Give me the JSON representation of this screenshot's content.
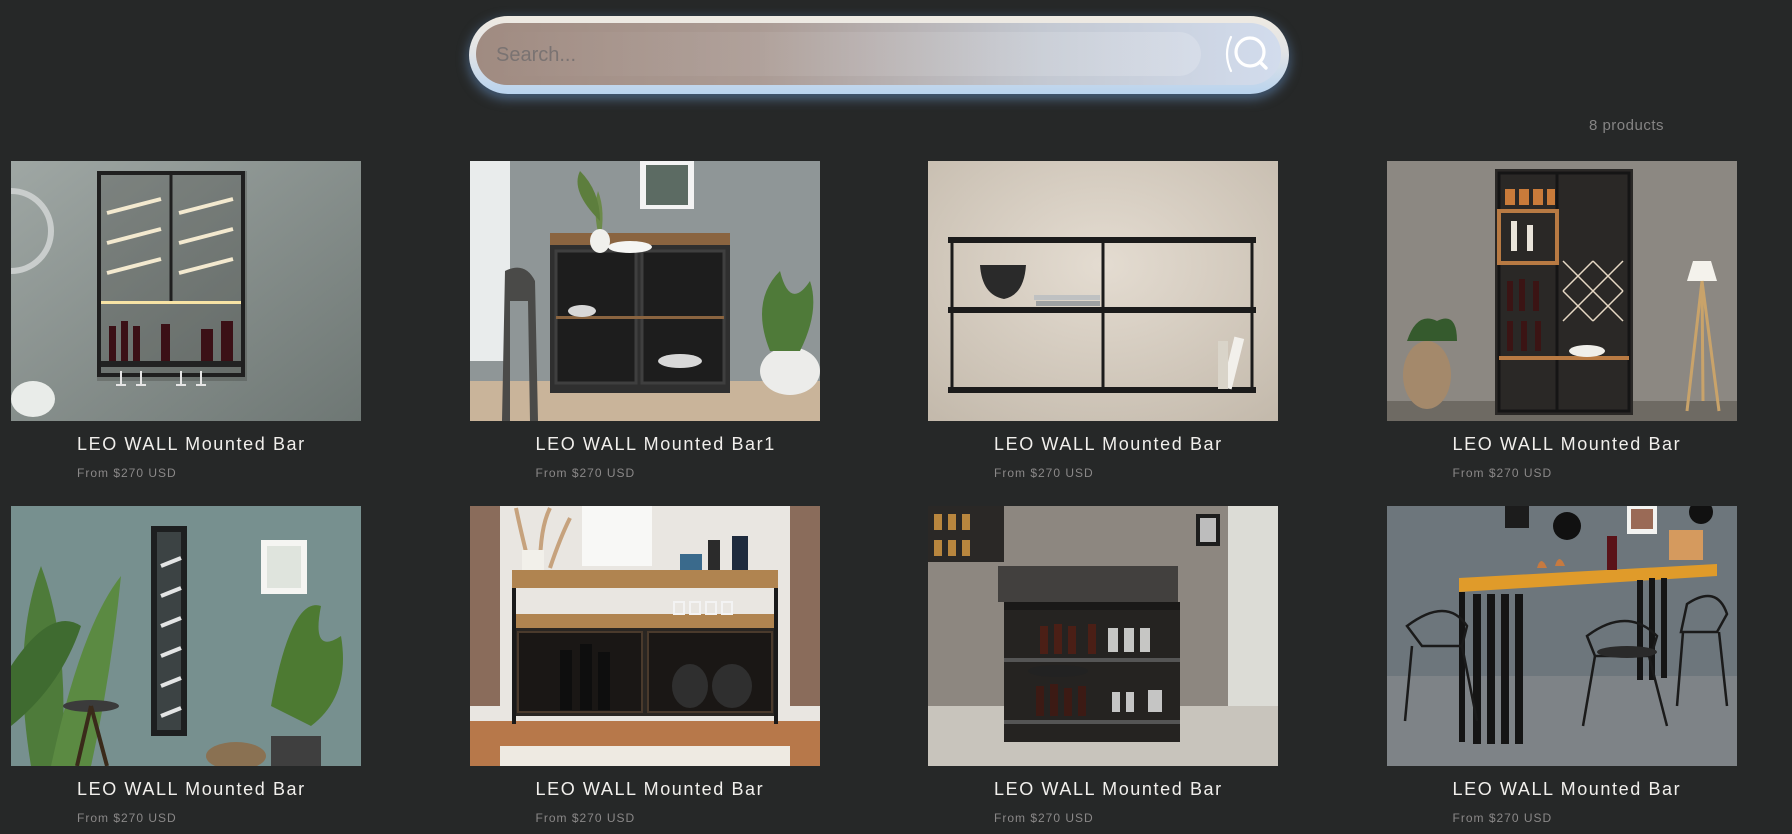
{
  "search": {
    "placeholder": "Search...",
    "value": "",
    "icon": "search-icon"
  },
  "results": {
    "count_label": "8 products"
  },
  "products": [
    {
      "title": "LEO WALL Mounted Bar",
      "price": "From $270 USD",
      "image": "wall-wine-rack-photo"
    },
    {
      "title": "LEO WALL Mounted Bar1",
      "price": "From $270 USD",
      "image": "bar-cabinet-photo"
    },
    {
      "title": "LEO WALL Mounted Bar",
      "price": "From $270 USD",
      "image": "console-shelf-photo"
    },
    {
      "title": "LEO WALL Mounted Bar",
      "price": "From $270 USD",
      "image": "tall-bar-unit-photo"
    },
    {
      "title": "LEO WALL Mounted Bar",
      "price": "From $270 USD",
      "image": "vertical-wine-rack-photo"
    },
    {
      "title": "LEO WALL Mounted Bar",
      "price": "From $270 USD",
      "image": "sideboard-photo"
    },
    {
      "title": "LEO WALL Mounted Bar",
      "price": "From $270 USD",
      "image": "home-bar-counter-photo"
    },
    {
      "title": "LEO WALL Mounted Bar",
      "price": "From $270 USD",
      "image": "bar-table-set-photo"
    }
  ],
  "colors": {
    "background": "#262828",
    "title_text": "#f1efec",
    "price_text": "#8a8888",
    "search_glow": "#76a8e4"
  }
}
